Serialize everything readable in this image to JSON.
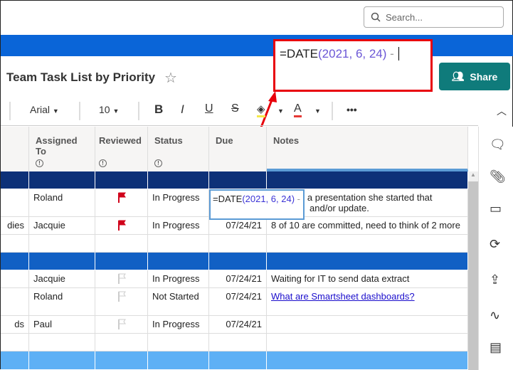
{
  "search": {
    "placeholder": "Search..."
  },
  "sheet": {
    "title": "Team Task List by Priority"
  },
  "formula_bar": {
    "prefix": "=DATE",
    "args": "(2021, 6, 24)"
  },
  "share_label": "Share",
  "toolbar": {
    "font": "Arial",
    "size": "10",
    "more": "•••"
  },
  "columns": [
    "Assigned To",
    "Reviewed",
    "Status",
    "Due",
    "Notes"
  ],
  "colors": {
    "group1": "#0d3178",
    "group2": "#1160c4",
    "group3": "#5eb0f5",
    "accent": "#0a65d8",
    "share": "#0f7b7b",
    "flag": "#d0021b"
  },
  "rows": [
    {
      "primary": "",
      "assigned": "Roland",
      "flag": "red",
      "status": "In Progress",
      "due": "",
      "notes": "y have a presentation she started that",
      "notes2": "and/or update."
    },
    {
      "primary": "dies",
      "assigned": "Jacquie",
      "flag": "red",
      "status": "In Progress",
      "due": "07/24/21",
      "notes": "8 of 10 are committed, need to think of 2 more"
    },
    {
      "primary": "",
      "assigned": "Jacquie",
      "flag": "empty",
      "status": "In Progress",
      "due": "07/24/21",
      "notes": "Waiting for IT to send data extract"
    },
    {
      "primary": "",
      "assigned": "Roland",
      "flag": "empty",
      "status": "Not Started",
      "due": "07/24/21",
      "link": "What are Smartsheet dashboards?"
    },
    {
      "primary": "ds",
      "assigned": "Paul",
      "flag": "empty",
      "status": "In Progress",
      "due": "07/24/21",
      "notes": ""
    }
  ],
  "cell_editor": {
    "prefix": "=DATE",
    "args": "(2021, 6, 24)"
  }
}
